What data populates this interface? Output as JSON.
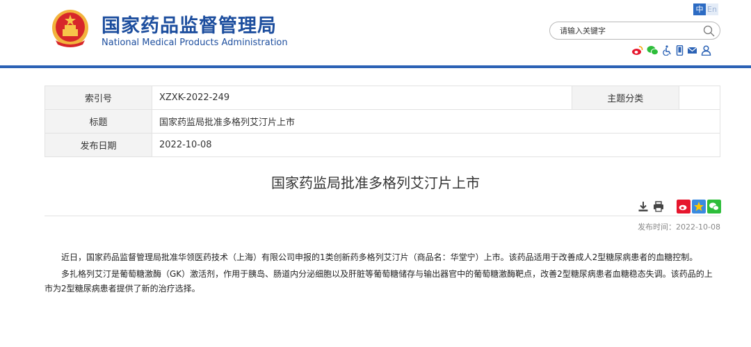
{
  "header": {
    "title_cn": "国家药品监督管理局",
    "title_en": "National Medical Products Administration",
    "lang_zh": "中",
    "lang_en": "En",
    "search_placeholder": "请输入关键字",
    "tool_icons": [
      "weibo-icon",
      "wechat-icon",
      "accessibility-icon",
      "mobile-icon",
      "mail-icon",
      "user-icon"
    ],
    "brand_color": "#1d4e9e"
  },
  "info": {
    "index_label": "索引号",
    "index_value": "XZXK-2022-249",
    "topic_label": "主题分类",
    "topic_value": "",
    "title_label": "标题",
    "title_value": "国家药监局批准多格列艾汀片上市",
    "date_label": "发布日期",
    "date_value": "2022-10-08"
  },
  "article": {
    "title": "国家药监局批准多格列艾汀片上市",
    "publish_time": "发布时间：2022-10-08",
    "paragraphs": [
      "近日，国家药品监督管理局批准华领医药技术（上海）有限公司申报的1类创新药多格列艾汀片（商品名：华堂宁）上市。该药品适用于改善成人2型糖尿病患者的血糖控制。",
      "多扎格列艾汀是葡萄糖激酶（GK）激活剂，作用于胰岛、肠道内分泌细胞以及肝脏等葡萄糖储存与输出器官中的葡萄糖激酶靶点，改善2型糖尿病患者血糖稳态失调。该药品的上市为2型糖尿病患者提供了新的治疗选择。"
    ],
    "action_icons": [
      "download-icon",
      "print-icon"
    ],
    "share_icons": [
      "weibo-share-icon",
      "qzone-share-icon",
      "wechat-share-icon"
    ]
  }
}
